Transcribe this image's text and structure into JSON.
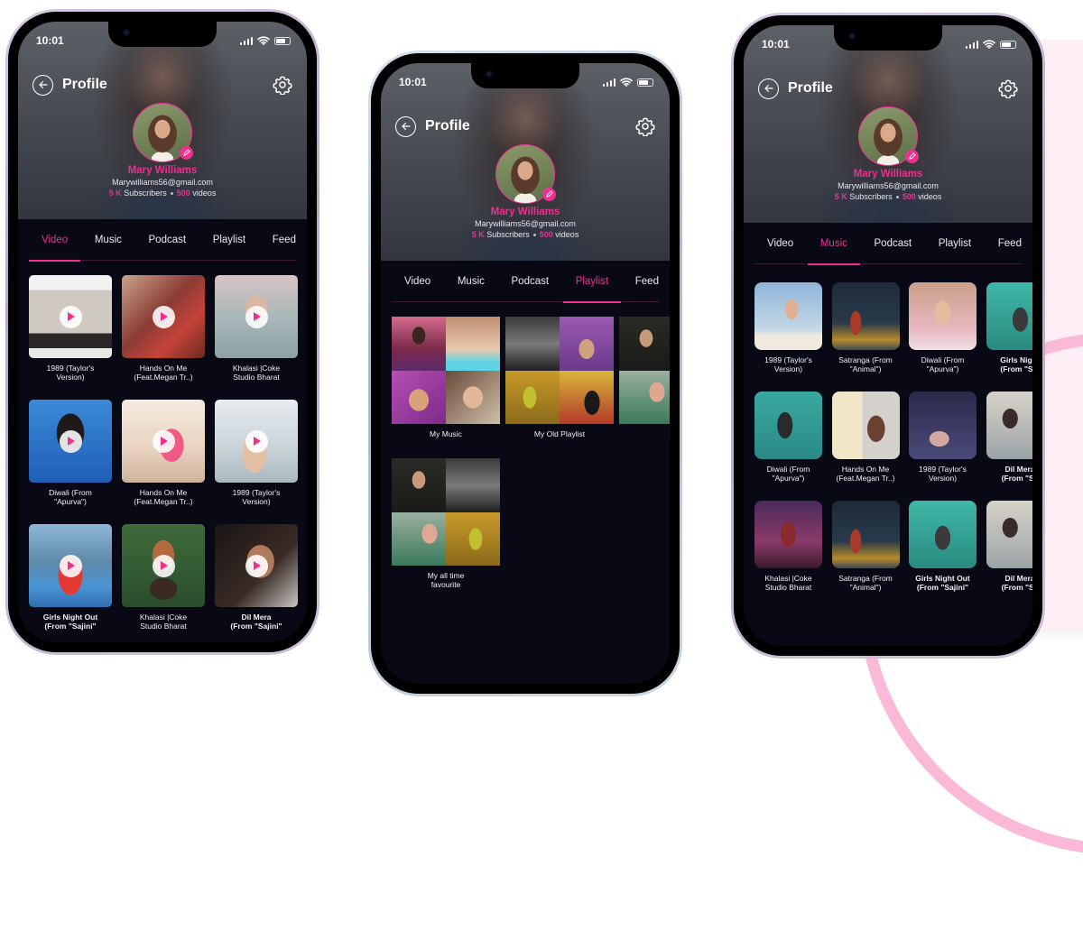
{
  "colors": {
    "accent": "#ef2f8f",
    "screen_bg": "#080914",
    "text": "#f1f1f4"
  },
  "status_bar": {
    "time": "10:01",
    "icons": [
      "signal-icon",
      "wifi-icon",
      "battery-icon"
    ]
  },
  "header": {
    "title": "Profile",
    "back_icon": "back-arrow-circle-icon",
    "settings_icon": "gear-icon"
  },
  "profile": {
    "name": "Mary Williams",
    "email": "Marywilliams56@gmail.com",
    "subscribers_value": "5 K",
    "subscribers_label": "Subscribers",
    "videos_value": "500",
    "videos_label": "videos",
    "edit_icon": "pencil-icon"
  },
  "tabs": [
    "Video",
    "Music",
    "Podcast",
    "Playlist",
    "Feed"
  ],
  "screens": [
    {
      "active_tab": "Video",
      "videos": [
        {
          "title": "1989 (Taylor's\nVersion)",
          "bold": false
        },
        {
          "title": "Hands On Me\n(Feat.Megan Tr..)",
          "bold": false
        },
        {
          "title": "Khalasi |Coke\nStudio Bharat",
          "bold": false
        },
        {
          "title": "Diwali (From\n\"Apurva\")",
          "bold": false
        },
        {
          "title": "Hands On Me\n(Feat.Megan Tr..)",
          "bold": false
        },
        {
          "title": "1989 (Taylor's\nVersion)",
          "bold": false
        },
        {
          "title": "Girls Night Out\n(From \"Sajini\"",
          "bold": true
        },
        {
          "title": "Khalasi |Coke\nStudio Bharat",
          "bold": false
        },
        {
          "title": "Dil Mera\n(From \"Sajini\"",
          "bold": true
        }
      ]
    },
    {
      "active_tab": "Playlist",
      "playlists": [
        {
          "title": "My Music"
        },
        {
          "title": "My Old Playlist"
        },
        {
          "title": "La"
        },
        {
          "title": "My all time\nfavourite"
        }
      ]
    },
    {
      "active_tab": "Music",
      "songs": [
        {
          "title": "1989 (Taylor's\nVersion)"
        },
        {
          "title": "Satranga (From\n\"Animal\")"
        },
        {
          "title": "Diwali (From\n\"Apurva\")"
        },
        {
          "title": "Girls Night\n(From \"Saj"
        },
        {
          "title": "Diwali (From\n\"Apurva\")"
        },
        {
          "title": "Hands On Me\n(Feat.Megan Tr..)"
        },
        {
          "title": "1989 (Taylor's\nVersion)"
        },
        {
          "title": "Dil Mera\n(From \"Sa"
        },
        {
          "title": "Khalasi |Coke\nStudio Bharat"
        },
        {
          "title": "Satranga (From\n\"Animal\")"
        },
        {
          "title": "Girls Night Out\n(From \"Sajini\""
        },
        {
          "title": "Dil Mera\n(From \"Sa"
        }
      ]
    }
  ]
}
